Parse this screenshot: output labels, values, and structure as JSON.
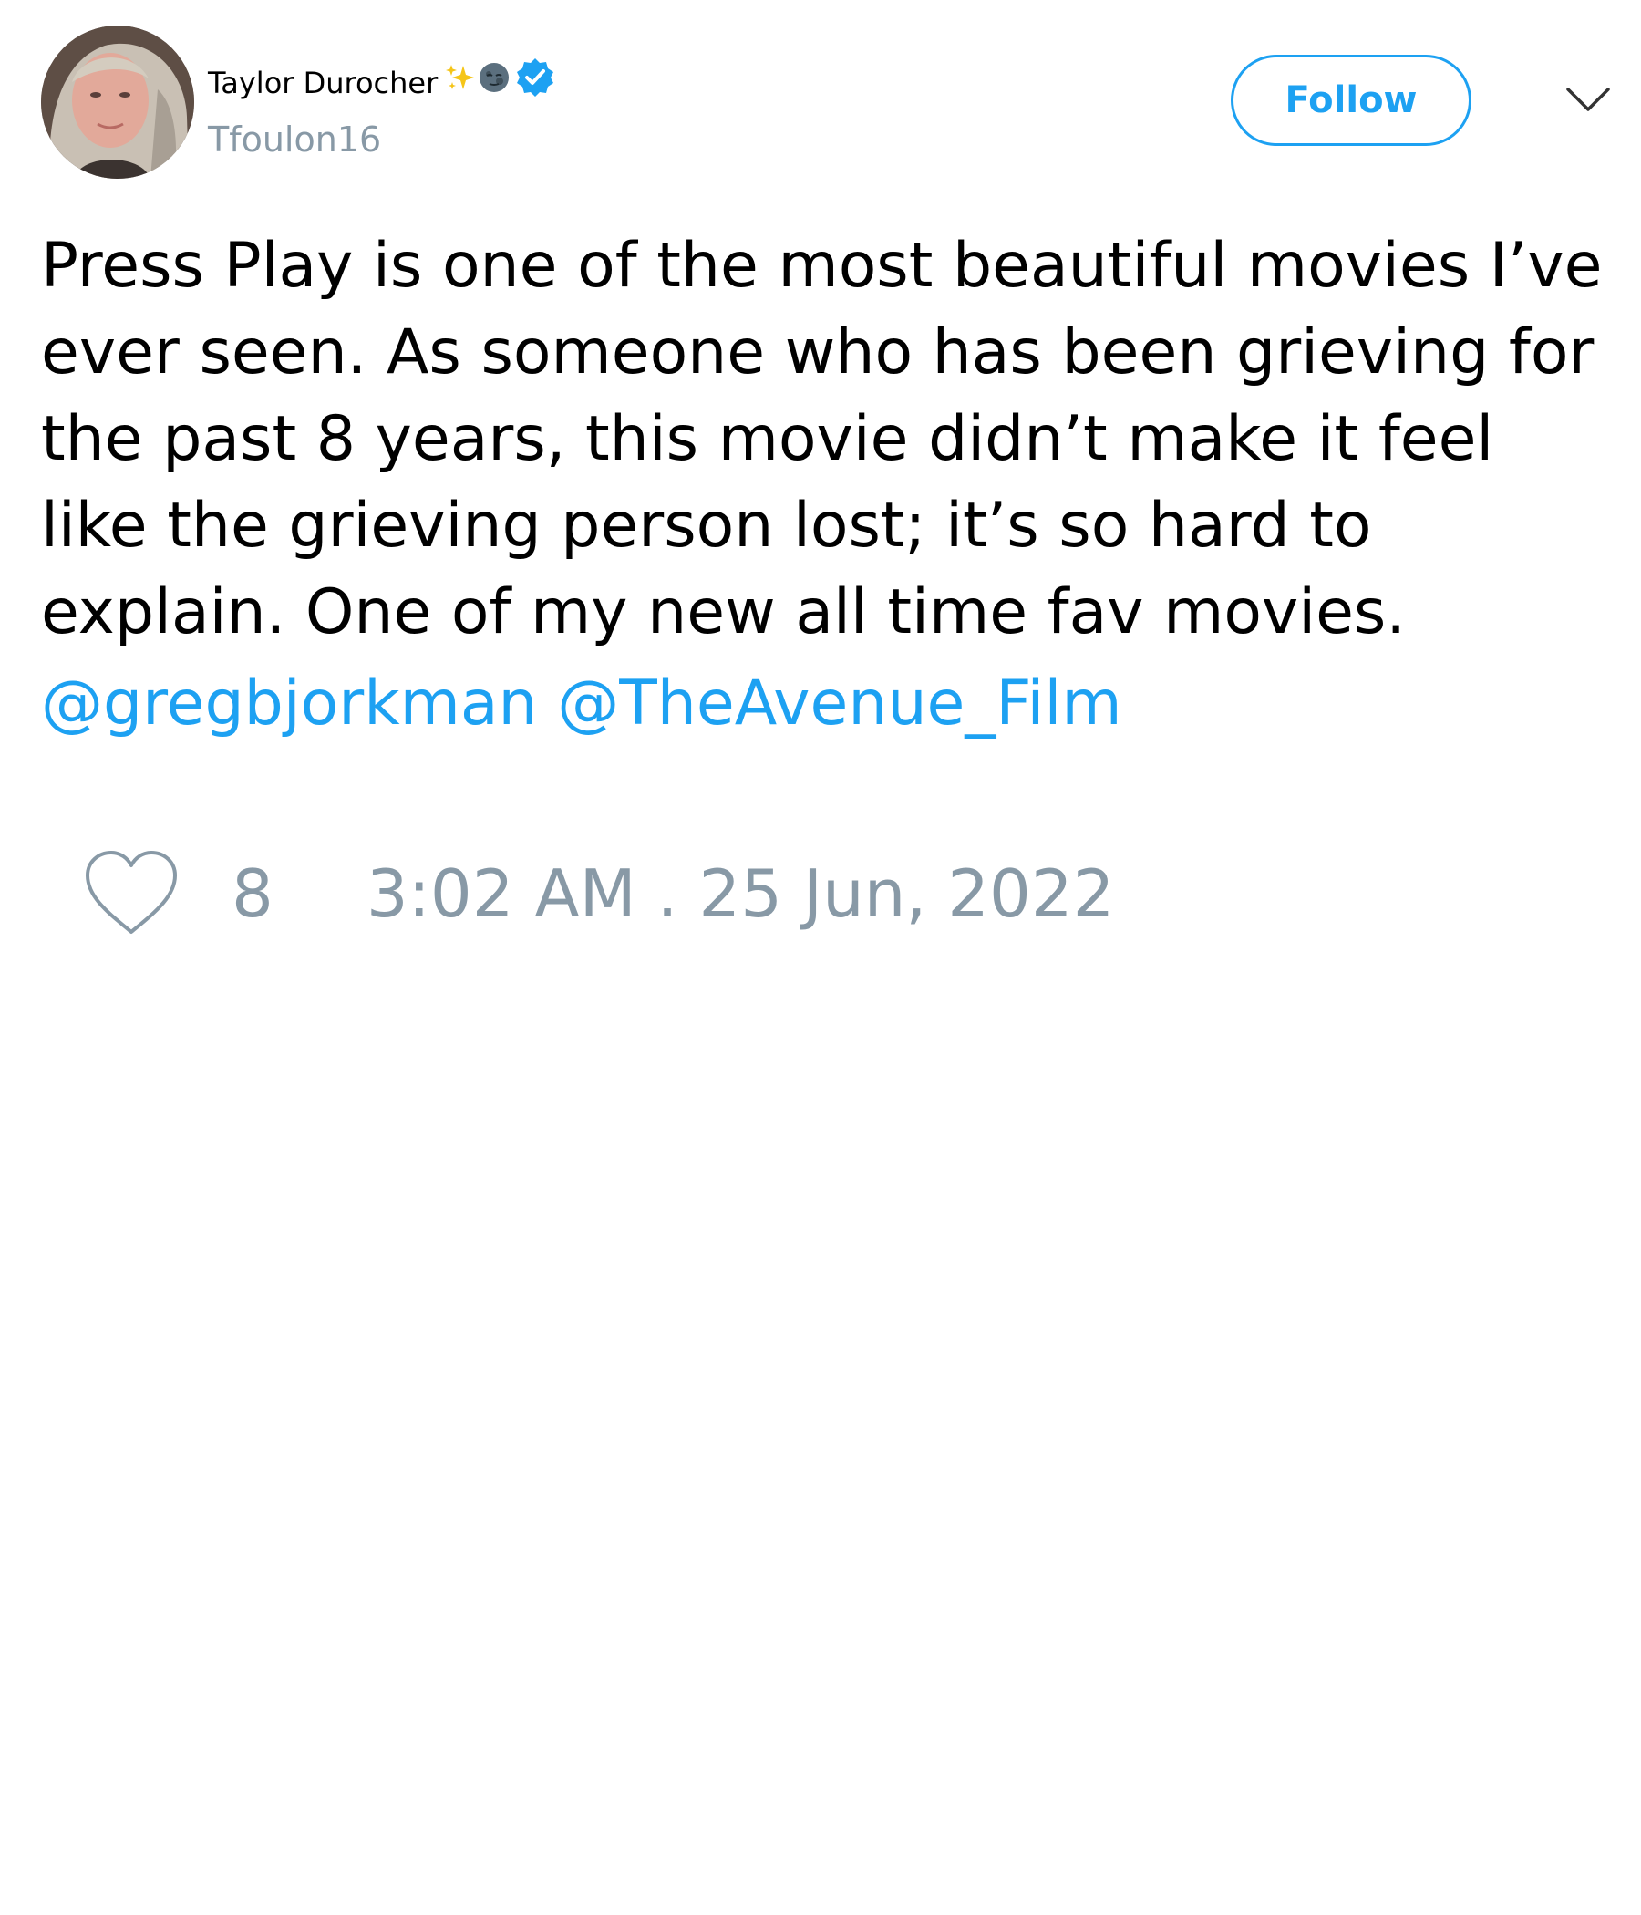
{
  "user": {
    "display_name": "Taylor Durocher",
    "name_emojis": [
      "sparkles-emoji",
      "new-moon-face-emoji"
    ],
    "verified": true,
    "handle": "Tfoulon16"
  },
  "header": {
    "follow_label": "Follow"
  },
  "tweet": {
    "lines": [
      "Press Play is one of the most beautiful movies I’ve",
      "ever seen. As someone who has been grieving for",
      "the past 8 years, this movie didn’t make it feel",
      "like the grieving person lost; it’s so hard to",
      "explain. One of my new all time fav movies."
    ],
    "mentions": [
      "@gregbjorkman",
      "@TheAvenue_Film"
    ]
  },
  "footer": {
    "like_count": "8",
    "timestamp": "3:02 AM . 25 Jun, 2022"
  },
  "colors": {
    "accent": "#1da1f2",
    "secondary_text": "#8899a6",
    "text": "#000000"
  }
}
